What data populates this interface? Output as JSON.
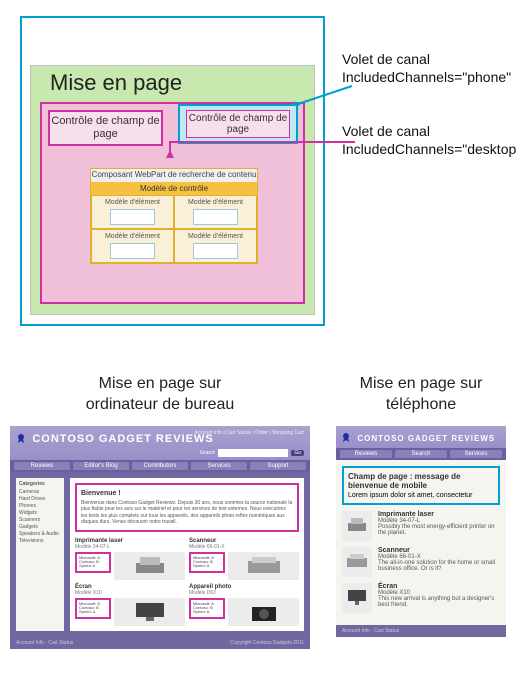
{
  "diagram": {
    "layout_title": "Mise en page",
    "field_desktop": "Contrôle de champ de page",
    "field_phone": "Contrôle de champ de page",
    "webpart_header": "Composant WebPart de recherche de contenu",
    "control_template": "Modèle de contrôle",
    "item_template": "Modèle d'élément",
    "label_phone_line1": "Volet de canal",
    "label_phone_line2": "IncludedChannels=\"phone\"",
    "label_desktop_line1": "Volet de canal",
    "label_desktop_line2": "IncludedChannels=\"desktop\""
  },
  "bottom": {
    "desktop_title_1": "Mise en page sur",
    "desktop_title_2": "ordinateur de bureau",
    "phone_title_1": "Mise en page sur",
    "phone_title_2": "téléphone"
  },
  "site": {
    "brand_prefix": "C",
    "brand_rest": "ONTOSO GADGET REVIEWS",
    "top_links": "Account Info  |  Cart Status  |  Order  |  Shopping Cart",
    "search_label": "Search",
    "go": "Go",
    "tabs": [
      "Reviews",
      "Editor's Blog",
      "Contributors",
      "Services",
      "Support"
    ],
    "phone_tabs": [
      "Reviews",
      "Search",
      "Services"
    ],
    "sidebar_header": "Categories",
    "sidebar": [
      "Cameras",
      "Hard Drives",
      "Phones",
      "Widgets",
      "Scanners",
      "Gadgets",
      "Speakers & Audio",
      "Televisions"
    ],
    "welcome_h": "Bienvenue !",
    "welcome_body": "Bienvenue dans Contoso Gadget Reviews. Depuis 30 ans, nous sommes la source nationale la plus fiable pour les avis sur le matériel et pour les services de test externes. Nous exécutons les tests les plus complets sur tous les appareils, des appareils photo reflex numériques aux disques durs. Venez découvrir notre travail.",
    "products": [
      {
        "title": "Imprimante laser",
        "model": "Modèle 34-07-L",
        "specs": "Microsoft: A\nContoso: B\nSpeed: A"
      },
      {
        "title": "Scanneur",
        "model": "Modèle 66-01-X",
        "specs": "Microsoft: A\nContoso: B\nSpeed: A"
      },
      {
        "title": "Écran",
        "model": "Modèle X10",
        "specs": "Microsoft: A\nContoso: B\nSpeed: A"
      },
      {
        "title": "Appareil photo",
        "model": "Modèle D6J",
        "specs": "Microsoft: A\nContoso: B\nSpeed: A"
      }
    ],
    "phone_field_h": "Champ de page : message de bienvenue de mobile",
    "phone_field_body": "Lorem ipsum dolor sit amet, consectetur",
    "phone_products": [
      {
        "title": "Imprimante laser",
        "model": "Modèle 34-07-L",
        "desc": "Possibly the most energy-efficient printer on the planet."
      },
      {
        "title": "Scanneur",
        "model": "Modèle 66-01-X",
        "desc": "The all-in-one solution for the home or small business office. Or is it?"
      },
      {
        "title": "Écran",
        "model": "Modèle X10",
        "desc": "This new arrival is anything but a designer's best friend."
      }
    ],
    "footer_left": "Account Info  ·  Cart Status",
    "footer_right": "Copyright Contoso Gadgets 2011"
  }
}
